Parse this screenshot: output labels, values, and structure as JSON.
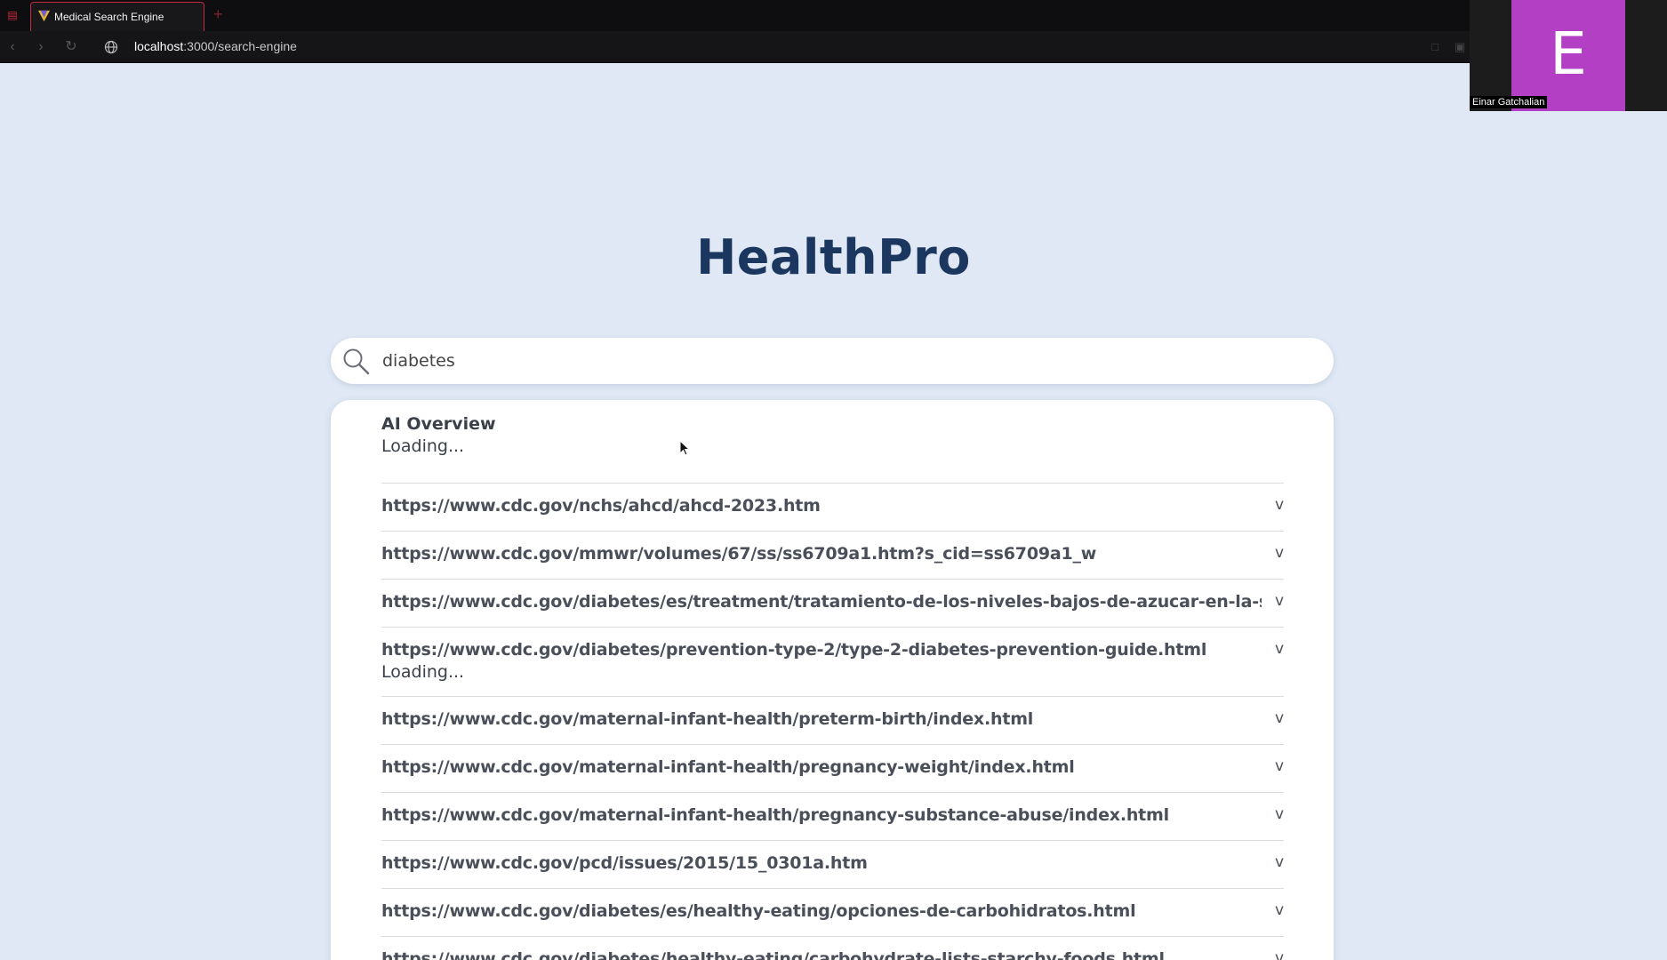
{
  "browser": {
    "tab_title": "Medical Search Engine",
    "url_host": "localhost",
    "url_path": ":3000/search-engine",
    "accent_color": "#c4283f"
  },
  "video_call": {
    "initial": "E",
    "participant_name": "Einar Gatchalian",
    "tile_color": "#b23fc4"
  },
  "app": {
    "title": "HealthPro",
    "title_color": "#1b3760",
    "background": "#dfe8f4"
  },
  "search": {
    "query": "diabetes"
  },
  "ai_overview": {
    "title": "AI Overview",
    "status": "Loading..."
  },
  "results": [
    {
      "url": "https://www.cdc.gov/nchs/ahcd/ahcd-2023.htm",
      "toggle": "v",
      "status": ""
    },
    {
      "url": "https://www.cdc.gov/mmwr/volumes/67/ss/ss6709a1.htm?s_cid=ss6709a1_w",
      "toggle": "v",
      "status": ""
    },
    {
      "url": "https://www.cdc.gov/diabetes/es/treatment/tratamiento-de-los-niveles-bajos-de-azucar-en-la-sang",
      "toggle": "v",
      "status": ""
    },
    {
      "url": "https://www.cdc.gov/diabetes/prevention-type-2/type-2-diabetes-prevention-guide.html",
      "toggle": "v",
      "status": "Loading..."
    },
    {
      "url": "https://www.cdc.gov/maternal-infant-health/preterm-birth/index.html",
      "toggle": "v",
      "status": ""
    },
    {
      "url": "https://www.cdc.gov/maternal-infant-health/pregnancy-weight/index.html",
      "toggle": "v",
      "status": ""
    },
    {
      "url": "https://www.cdc.gov/maternal-infant-health/pregnancy-substance-abuse/index.html",
      "toggle": "v",
      "status": ""
    },
    {
      "url": "https://www.cdc.gov/pcd/issues/2015/15_0301a.htm",
      "toggle": "v",
      "status": ""
    },
    {
      "url": "https://www.cdc.gov/diabetes/es/healthy-eating/opciones-de-carbohidratos.html",
      "toggle": "v",
      "status": ""
    },
    {
      "url": "https://www.cdc.gov/diabetes/healthy-eating/carbohydrate-lists-starchy-foods.html",
      "toggle": "v",
      "status": ""
    }
  ]
}
